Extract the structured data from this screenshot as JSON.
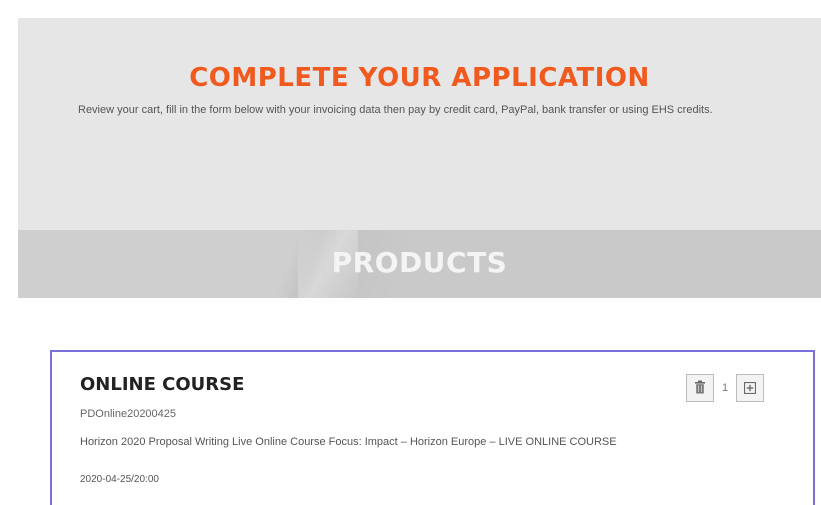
{
  "header": {
    "title": "COMPLETE YOUR APPLICATION",
    "description": "Review your cart, fill in the form below with your invoicing data then pay by credit card, PayPal, bank transfer or using EHS credits."
  },
  "products_section": {
    "title": "PRODUCTS"
  },
  "product": {
    "title": "ONLINE COURSE",
    "code": "PDOnline20200425",
    "description": "Horizon 2020 Proposal Writing Live Online Course Focus: Impact – Horizon Europe – LIVE ONLINE COURSE",
    "date": "2020-04-25/20:00",
    "quantity": "1",
    "delete_icon": "trash-icon",
    "add_icon": "plus-icon"
  },
  "colors": {
    "accent": "#f05a1e",
    "card_border": "#7b6fd9",
    "panel_bg": "#e6e6e6",
    "band_bg": "#cfcfcf"
  }
}
